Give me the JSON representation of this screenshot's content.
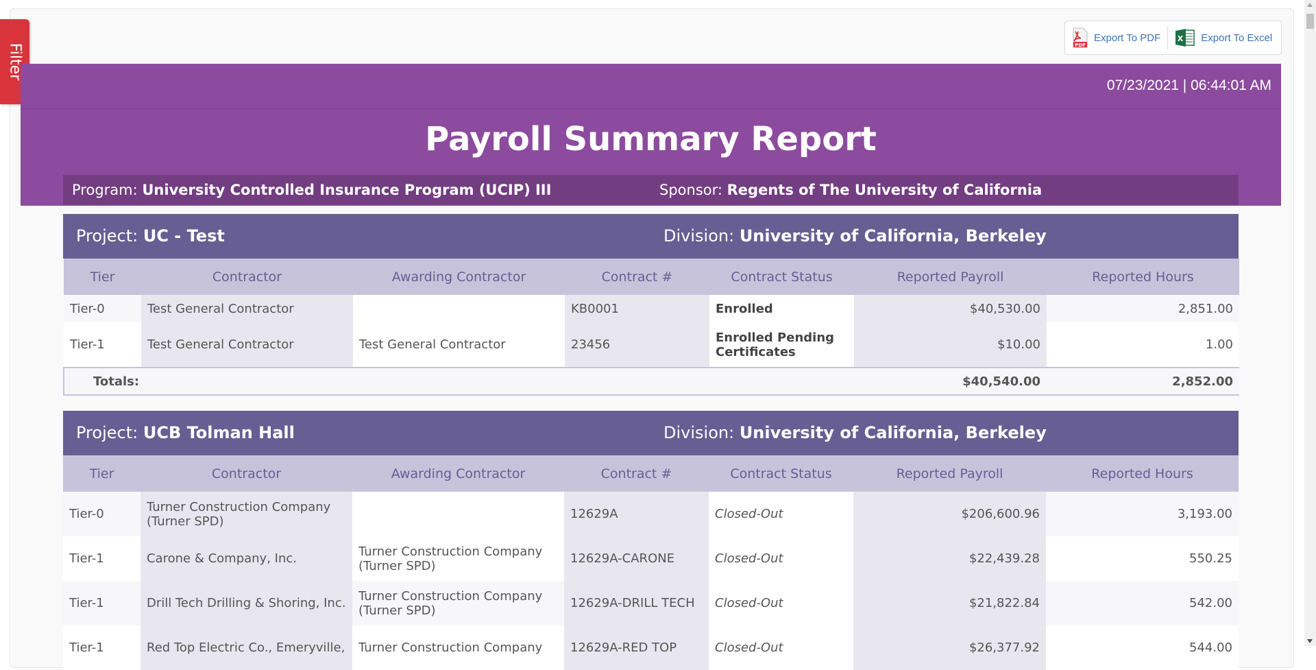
{
  "filter_label": "Filter",
  "export": {
    "pdf_label": "Export To PDF",
    "excel_label": "Export To Excel"
  },
  "banner": {
    "timestamp": "07/23/2021 | 06:44:01 AM",
    "title": "Payroll Summary Report",
    "program_label": "Program:",
    "program_value": "University Controlled Insurance Program (UCIP) III",
    "sponsor_label": "Sponsor:",
    "sponsor_value": "Regents of The University of California"
  },
  "columns": [
    "Tier",
    "Contractor",
    "Awarding Contractor",
    "Contract #",
    "Contract Status",
    "Reported Payroll",
    "Reported Hours"
  ],
  "projects": [
    {
      "project_label": "Project:",
      "project_value": "UC - Test",
      "division_label": "Division:",
      "division_value": "University of California, Berkeley",
      "rows": [
        [
          "Tier-0",
          "Test General Contractor",
          "",
          "KB0001",
          "Enrolled",
          "$40,530.00",
          "2,851.00"
        ],
        [
          "Tier-1",
          "Test General Contractor",
          "Test General Contractor",
          "23456",
          "Enrolled Pending Certificates",
          "$10.00",
          "1.00"
        ]
      ],
      "totals_label": "Totals:",
      "totals_payroll": "$40,540.00",
      "totals_hours": "2,852.00"
    },
    {
      "project_label": "Project:",
      "project_value": "UCB Tolman Hall",
      "division_label": "Division:",
      "division_value": "University of California, Berkeley",
      "rows": [
        [
          "Tier-0",
          "Turner Construction Company (Turner SPD)",
          "",
          "12629A",
          "Closed-Out",
          "$206,600.96",
          "3,193.00"
        ],
        [
          "Tier-1",
          "Carone & Company, Inc.",
          "Turner Construction Company (Turner SPD)",
          "12629A-CARONE",
          "Closed-Out",
          "$22,439.28",
          "550.25"
        ],
        [
          "Tier-1",
          "Drill Tech Drilling & Shoring, Inc.",
          "Turner Construction Company (Turner SPD)",
          "12629A-DRILL TECH",
          "Closed-Out",
          "$21,822.84",
          "542.00"
        ],
        [
          "Tier-1",
          "Red Top Electric Co., Emeryville,",
          "Turner Construction Company",
          "12629A-RED TOP",
          "Closed-Out",
          "$26,377.92",
          "544.00"
        ]
      ]
    }
  ]
}
